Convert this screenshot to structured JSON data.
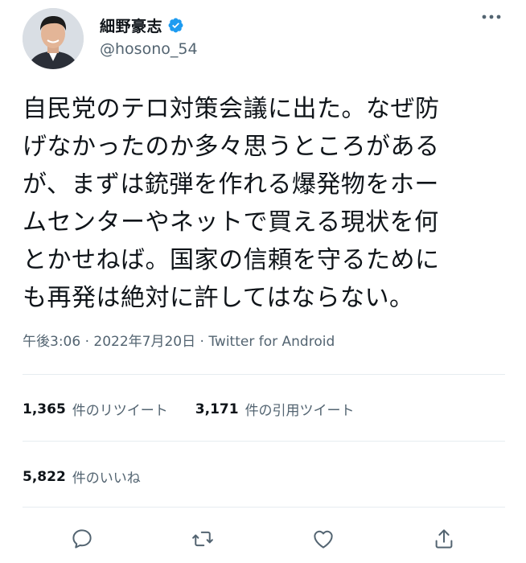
{
  "author": {
    "display_name": "細野豪志",
    "handle": "@hosono_54",
    "avatar_icon": "profile-photo",
    "verified_icon": "verified-badge-icon",
    "verified_color": "#1d9bf0"
  },
  "tweet": {
    "lines": [
      "自民党のテロ対策会議に出た。なぜ防",
      "げなかったのか多々思うところがある",
      "が、まずは銃弾を作れる爆発物をホー",
      "ムセンターやネットで買える現状を何",
      "とかせねば。国家の信頼を守るために",
      "も再発は絶対に許してはならない。"
    ],
    "time": "午後3:06",
    "date": "2022年7月20日",
    "source": "Twitter for Android",
    "separator": " · "
  },
  "stats": {
    "retweets_count": "1,365",
    "retweets_label": "件のリツイート",
    "quotes_count": "3,171",
    "quotes_label": "件の引用ツイート",
    "likes_count": "5,822",
    "likes_label": "件のいいね"
  },
  "actions": [
    "reply-icon",
    "retweet-icon",
    "like-icon",
    "share-icon"
  ],
  "colors": {
    "text": "#0f1419",
    "secondary": "#536471",
    "divider": "#e6ecf0",
    "icon": "#536471"
  }
}
